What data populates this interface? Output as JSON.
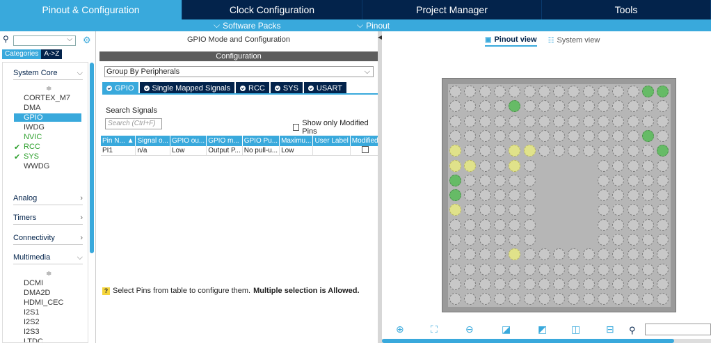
{
  "top_tabs": [
    {
      "label": "Pinout & Configuration",
      "active": true
    },
    {
      "label": "Clock Configuration",
      "active": false
    },
    {
      "label": "Project Manager",
      "active": false
    },
    {
      "label": "Tools",
      "active": false
    }
  ],
  "sub_bar": {
    "software_packs": "Software Packs",
    "pinout": "Pinout"
  },
  "left": {
    "category_tabs": [
      "Categories",
      "A->Z"
    ],
    "groups": {
      "system_core": "System Core",
      "analog": "Analog",
      "timers": "Timers",
      "connectivity": "Connectivity",
      "multimedia": "Multimedia"
    },
    "system_core_items": [
      "CORTEX_M7",
      "DMA",
      "GPIO",
      "IWDG",
      "NVIC",
      "RCC",
      "SYS",
      "WWDG"
    ],
    "multimedia_items": [
      "DCMI",
      "DMA2D",
      "HDMI_CEC",
      "I2S1",
      "I2S2",
      "I2S3",
      "LTDC"
    ]
  },
  "middle": {
    "title": "GPIO Mode and Configuration",
    "config_header": "Configuration",
    "group_by": "Group By Peripherals",
    "peripheral_tabs": [
      "GPIO",
      "Single Mapped Signals",
      "RCC",
      "SYS",
      "USART"
    ],
    "search_label": "Search Signals",
    "search_placeholder": "Search (Ctrl+F)",
    "show_only_modified": "Show only Modified Pins",
    "table": {
      "headers": [
        "Pin N...",
        "Signal o...",
        "GPIO ou...",
        "GPIO m...",
        "GPIO Pu...",
        "Maximu...",
        "User Label",
        "Modified"
      ],
      "rows": [
        [
          "PI1",
          "n/a",
          "Low",
          "Output P...",
          "No pull-u...",
          "Low",
          "",
          ""
        ]
      ]
    },
    "hint": "Select Pins from table to configure them.",
    "hint_bold": "Multiple selection is Allowed."
  },
  "right": {
    "pinout_view": "Pinout view",
    "system_view": "System view"
  },
  "colors": {
    "accent": "#39a9dc",
    "navy": "#03234b",
    "green": "#66bb66",
    "yellow": "#e0e28a"
  }
}
